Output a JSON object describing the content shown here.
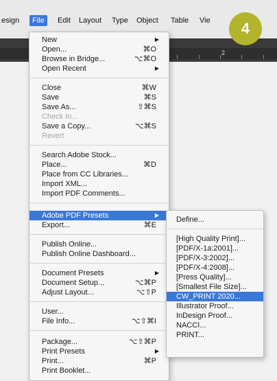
{
  "menubar": {
    "items": [
      "esign",
      "File",
      "Edit",
      "Layout",
      "Type",
      "Object",
      "Table",
      "Vie"
    ]
  },
  "ruler": {
    "label": "2"
  },
  "badge": {
    "number": "4"
  },
  "file_menu": {
    "new": {
      "label": "New"
    },
    "open": {
      "label": "Open...",
      "shortcut": "⌘O"
    },
    "browse": {
      "label": "Browse in Bridge...",
      "shortcut": "⌥⌘O"
    },
    "open_recent": {
      "label": "Open Recent"
    },
    "close": {
      "label": "Close",
      "shortcut": "⌘W"
    },
    "save": {
      "label": "Save",
      "shortcut": "⌘S"
    },
    "save_as": {
      "label": "Save As...",
      "shortcut": "⇧⌘S"
    },
    "check_in": {
      "label": "Check In..."
    },
    "save_copy": {
      "label": "Save a Copy...",
      "shortcut": "⌥⌘S"
    },
    "revert": {
      "label": "Revert"
    },
    "search_stock": {
      "label": "Search Adobe Stock..."
    },
    "place": {
      "label": "Place...",
      "shortcut": "⌘D"
    },
    "place_cc": {
      "label": "Place from CC Libraries..."
    },
    "import_xml": {
      "label": "Import XML..."
    },
    "import_pdf_comments": {
      "label": "Import PDF Comments..."
    },
    "pdf_presets": {
      "label": "Adobe PDF Presets"
    },
    "export": {
      "label": "Export...",
      "shortcut": "⌘E"
    },
    "publish_online": {
      "label": "Publish Online..."
    },
    "publish_dashboard": {
      "label": "Publish Online Dashboard..."
    },
    "document_presets": {
      "label": "Document Presets"
    },
    "document_setup": {
      "label": "Document Setup...",
      "shortcut": "⌥⌘P"
    },
    "adjust_layout": {
      "label": "Adjust Layout...",
      "shortcut": "⌥⇧P"
    },
    "user": {
      "label": "User..."
    },
    "file_info": {
      "label": "File Info...",
      "shortcut": "⌥⇧⌘I"
    },
    "package": {
      "label": "Package...",
      "shortcut": "⌥⇧⌘P"
    },
    "print_presets": {
      "label": "Print Presets"
    },
    "print": {
      "label": "Print...",
      "shortcut": "⌘P"
    },
    "print_booklet": {
      "label": "Print Booklet..."
    }
  },
  "pdf_submenu": {
    "items": [
      "Define...",
      "[High Quality Print]...",
      "[PDF/X-1a:2001]...",
      "[PDF/X-3:2002]...",
      "[PDF/X-4:2008]...",
      "[Press Quality]...",
      "[Smallest File Size]...",
      "CW_PRINT 2020...",
      "Illustrator Proof...",
      "InDesign Proof...",
      "NACCI...",
      "PRINT..."
    ]
  },
  "colors": {
    "highlight": "#3a78d8",
    "badge": "#b3b32c"
  },
  "icons": {
    "submenu_arrow": "triangle-right-icon"
  }
}
